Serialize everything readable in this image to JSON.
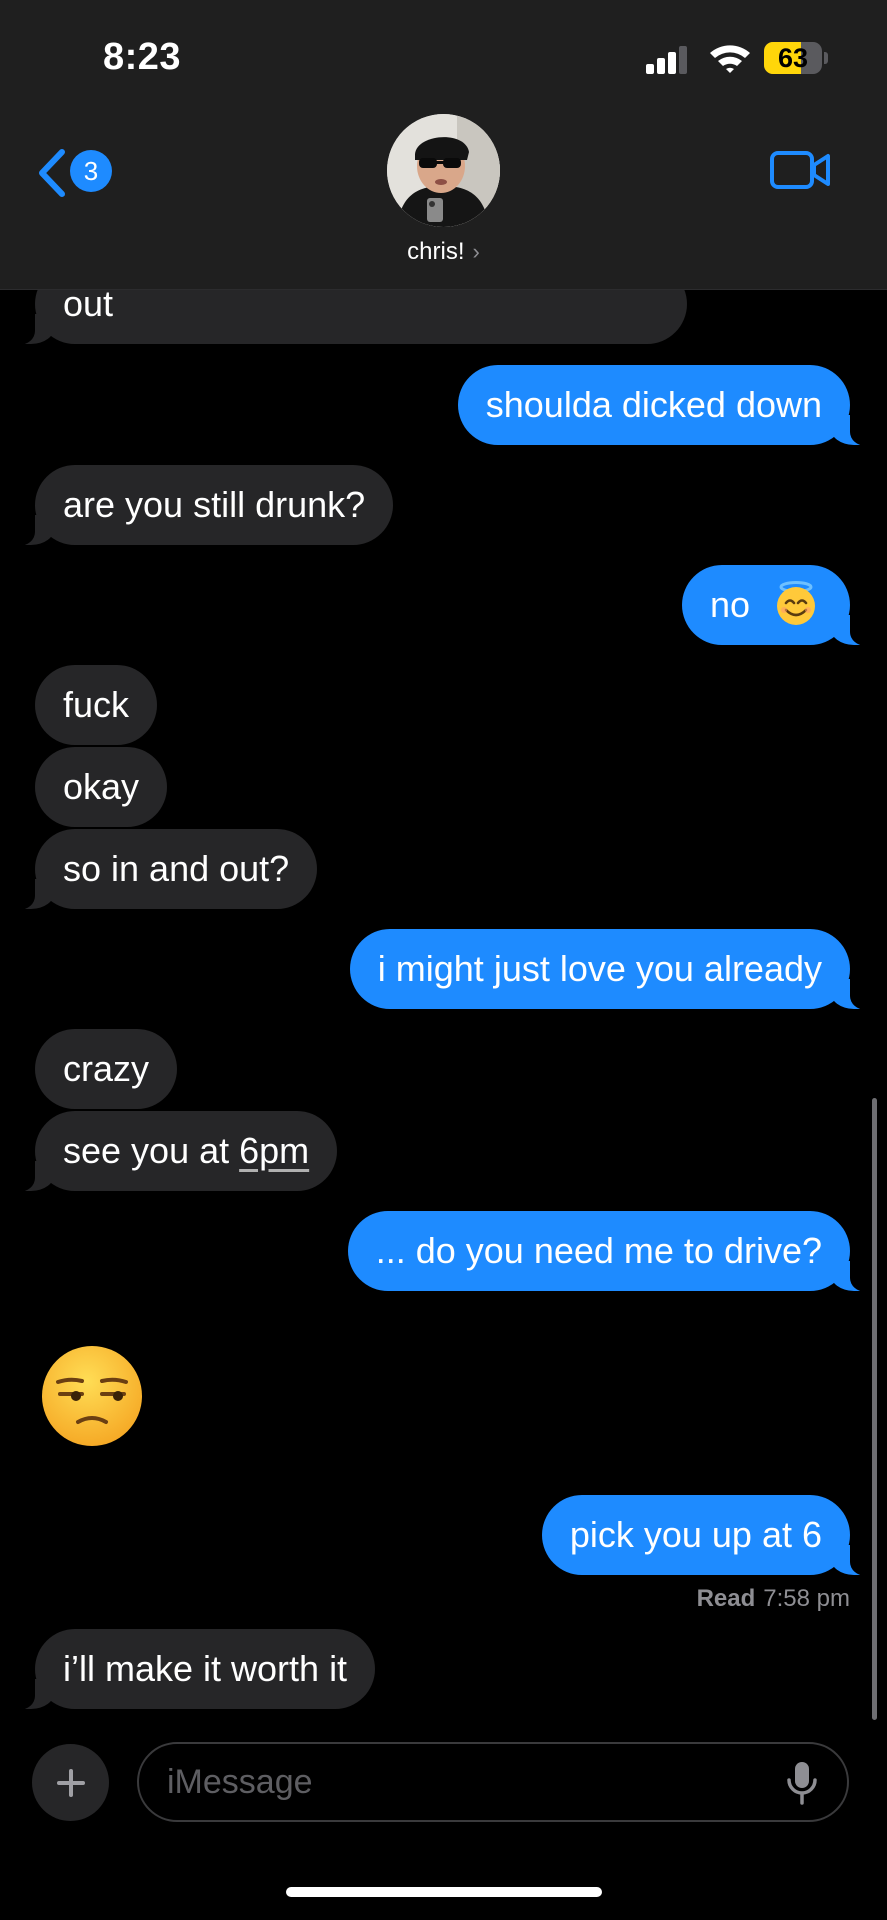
{
  "status_bar": {
    "time": "8:23",
    "battery_level": "63",
    "battery_fraction": 0.63,
    "signal_bars": 3,
    "signal_bars_total": 4
  },
  "header": {
    "back_badge_count": "3",
    "contact_name": "chris!",
    "contact_chevron": "›",
    "icons": {
      "back": "chevron-left-icon",
      "video": "video-camera-icon",
      "avatar": "contact-photo"
    }
  },
  "messages": [
    {
      "direction": "incoming",
      "text": "out"
    },
    {
      "direction": "outgoing",
      "text": "shoulda dicked down"
    },
    {
      "direction": "incoming",
      "text": "are you still drunk?"
    },
    {
      "direction": "outgoing",
      "text": "no",
      "emoji": "smiling-face-with-halo"
    },
    {
      "direction": "incoming",
      "text": "fuck"
    },
    {
      "direction": "incoming",
      "text": "okay"
    },
    {
      "direction": "incoming",
      "text": "so in and out?"
    },
    {
      "direction": "outgoing",
      "text": "i might just love you already"
    },
    {
      "direction": "incoming",
      "text": "crazy"
    },
    {
      "direction": "incoming",
      "text_prefix": "see you at ",
      "text_link": "6pm"
    },
    {
      "direction": "outgoing",
      "text": "... do you need me to drive?"
    },
    {
      "direction": "incoming",
      "emoji": "unamused-face"
    },
    {
      "direction": "outgoing",
      "text": "pick you up at 6"
    },
    {
      "direction": "incoming",
      "text": "i’ll make it worth it"
    }
  ],
  "read_receipt": {
    "label": "Read",
    "time": "7:58 pm"
  },
  "composer": {
    "placeholder": "iMessage",
    "icons": {
      "plus": "plus-icon",
      "mic": "microphone-icon"
    }
  },
  "colors": {
    "background": "#000000",
    "header_bg": "#1f1f1f",
    "incoming_bubble": "#262628",
    "outgoing_bubble": "#1e8bff",
    "accent": "#1e8bff",
    "battery": "#ffd60a",
    "secondary_text": "#8e8e93"
  }
}
